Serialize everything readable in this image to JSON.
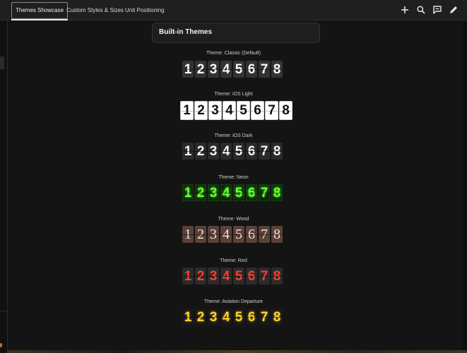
{
  "tabs": [
    {
      "label": "Themes Showcase",
      "active": true
    },
    {
      "label": "Custom Styles & Sizes",
      "active": false
    },
    {
      "label": "Unit Positioning",
      "active": false
    }
  ],
  "toolbar_icons": [
    "plus-icon",
    "search-icon",
    "comment-icon",
    "edit-pencil-icon"
  ],
  "section_title": "Built-in Themes",
  "themes": [
    {
      "label": "Theme: Classic (Default)",
      "digits": [
        "1",
        "2",
        "3",
        "4",
        "5",
        "6",
        "7",
        "8"
      ],
      "text_color": "#ffffff",
      "tile_color": "#333333"
    },
    {
      "label": "Theme: iOS Light",
      "digits": [
        "1",
        "2",
        "3",
        "4",
        "5",
        "6",
        "7",
        "8"
      ],
      "text_color": "#111111",
      "tile_color": "#ffffff"
    },
    {
      "label": "Theme: iOS Dark",
      "digits": [
        "1",
        "2",
        "3",
        "4",
        "5",
        "6",
        "7",
        "8"
      ],
      "text_color": "#f5f5f5",
      "tile_color": "#2a2a2a"
    },
    {
      "label": "Theme: Neon",
      "digits": [
        "1",
        "2",
        "3",
        "4",
        "5",
        "6",
        "7",
        "8"
      ],
      "text_color": "#6cff3a",
      "tile_color": "#0c1e0c"
    },
    {
      "label": "Theme: Wood",
      "digits": [
        "1",
        "2",
        "3",
        "4",
        "5",
        "6",
        "7",
        "8"
      ],
      "text_color": "#f3e6d6",
      "tile_color": "#5a4038"
    },
    {
      "label": "Theme: Red",
      "digits": [
        "1",
        "2",
        "3",
        "4",
        "5",
        "6",
        "7",
        "8"
      ],
      "text_color": "#ff3d2e",
      "tile_color": "#2b2b2b"
    },
    {
      "label": "Theme: Aviation Departure",
      "digits": [
        "1",
        "2",
        "3",
        "4",
        "5",
        "6",
        "7",
        "8"
      ],
      "text_color": "#ffd42a",
      "tile_color": "#181818"
    }
  ]
}
